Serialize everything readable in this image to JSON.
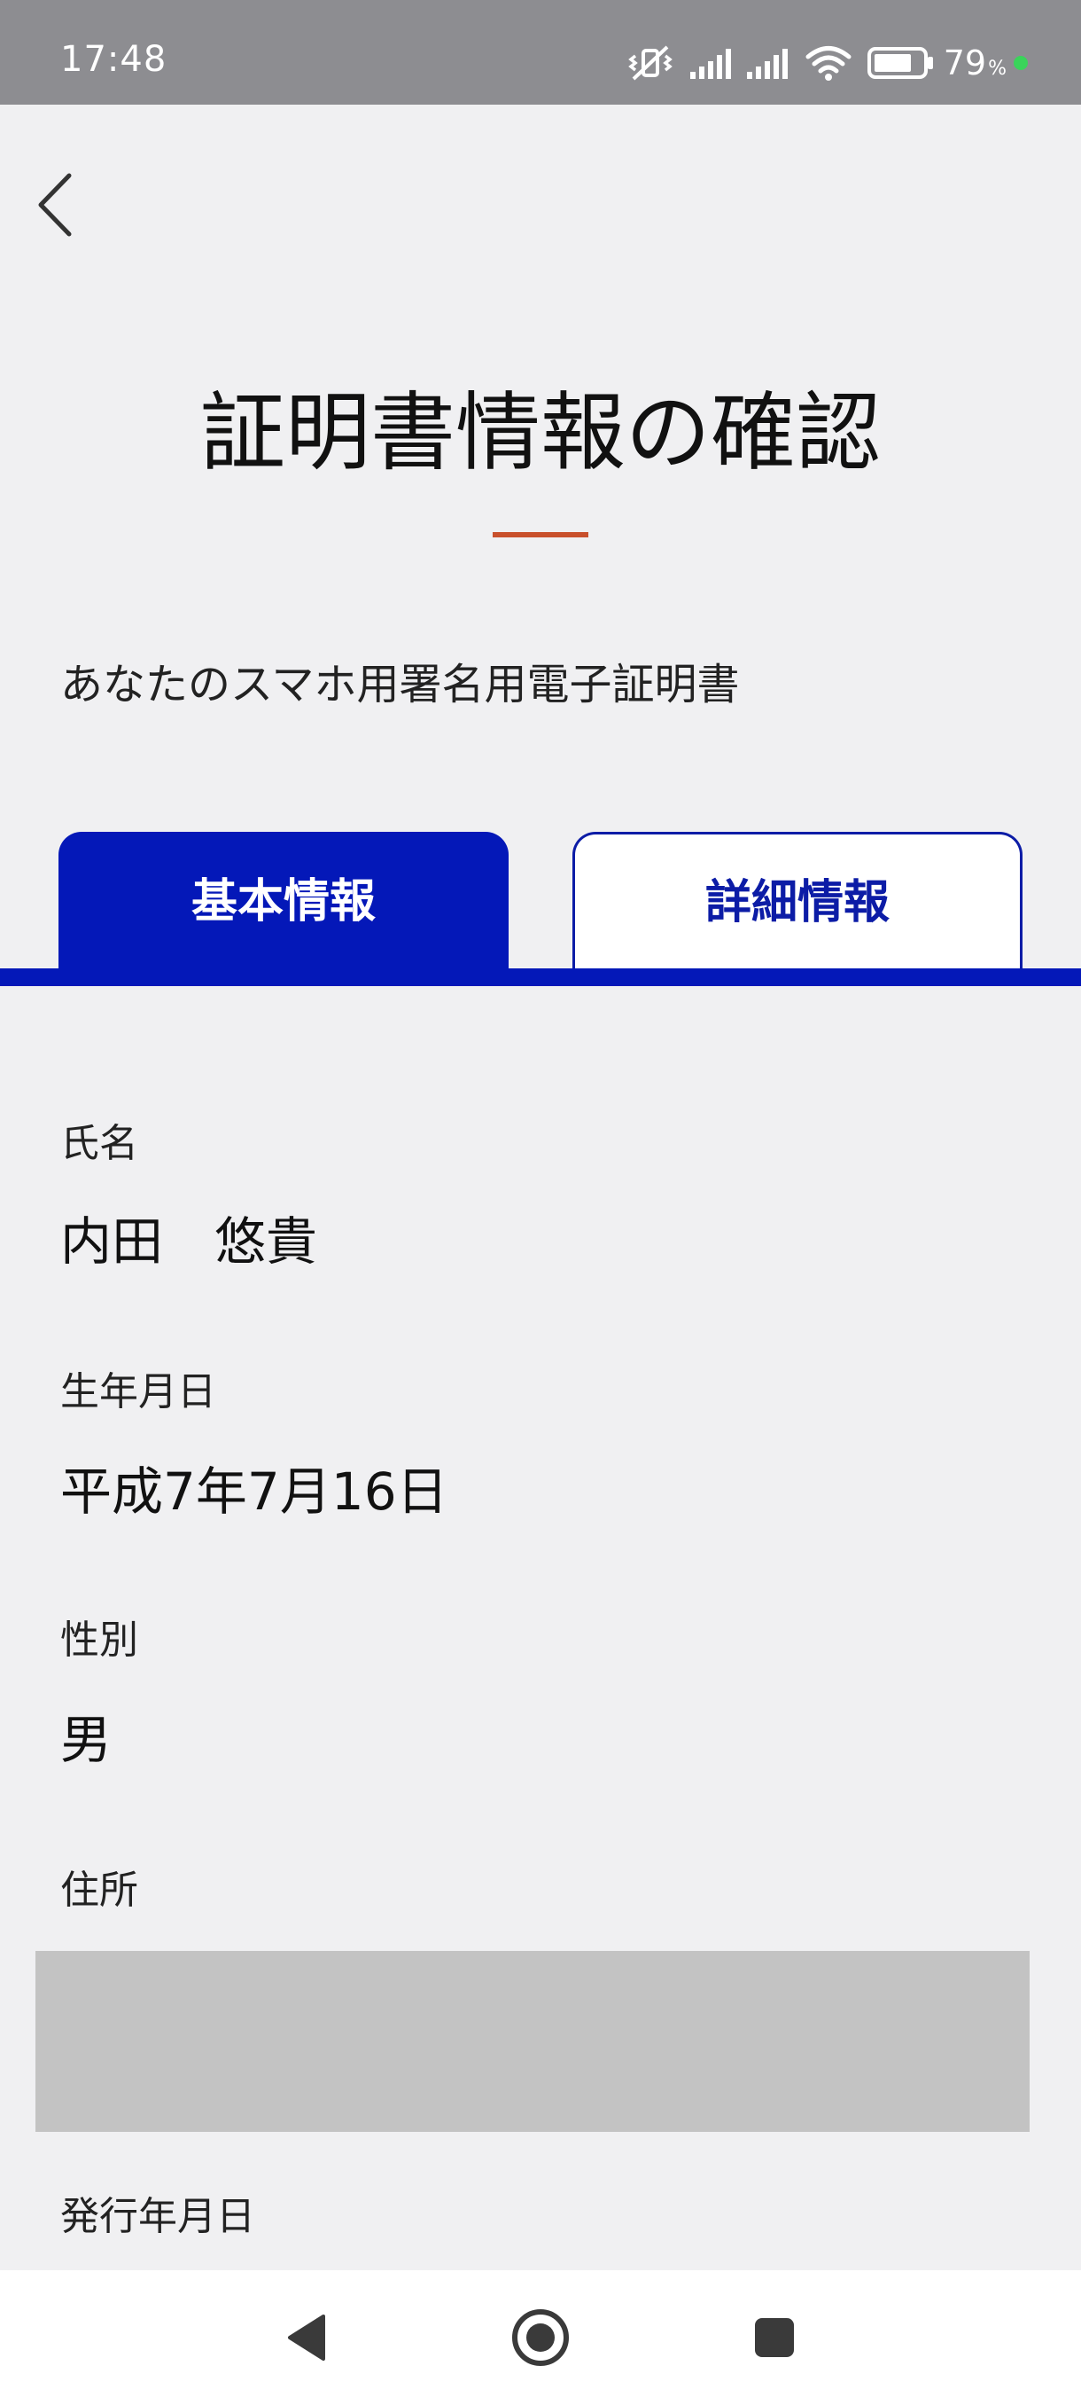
{
  "status_bar": {
    "time": "17:48",
    "battery_percent": "79",
    "battery_unit": "%",
    "icons": [
      "mute-vibrate-icon",
      "signal-icon",
      "signal-icon",
      "wifi-icon",
      "battery-icon"
    ],
    "battery_level": 0.79,
    "dot_color": "#3ad45a"
  },
  "header": {
    "back_icon": "chevron-left-icon",
    "title": "証明書情報の確認",
    "accent_color": "#c8502c"
  },
  "subtitle": "あなたのスマホ用署名用電子証明書",
  "tabs": [
    {
      "label": "基本情報",
      "active": true
    },
    {
      "label": "詳細情報",
      "active": false
    }
  ],
  "brand_color": "#0418b8",
  "fields": [
    {
      "label": "氏名",
      "value": "内田　悠貴"
    },
    {
      "label": "生年月日",
      "value": "平成7年7月16日"
    },
    {
      "label": "性別",
      "value": "男"
    },
    {
      "label": "住所",
      "value": ""
    },
    {
      "label": "発行年月日",
      "value": ""
    }
  ],
  "nav_bar": {
    "buttons": [
      "back-triangle-icon",
      "home-circle-icon",
      "recents-square-icon"
    ]
  }
}
